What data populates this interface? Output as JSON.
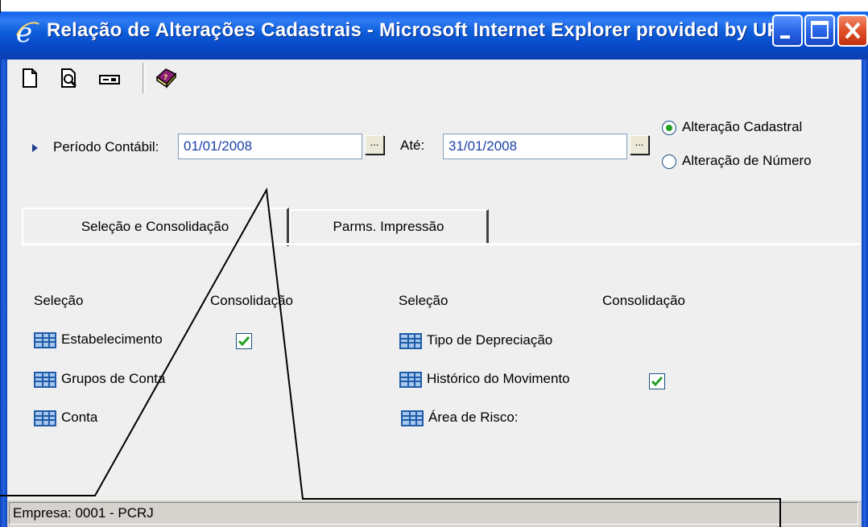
{
  "window": {
    "title": "Relação de Alterações Cadastrais - Microsoft Internet Explorer provided by UF…",
    "controls": [
      "minimize",
      "maximize",
      "close"
    ]
  },
  "toolbar": {
    "icons": [
      "new-document-icon",
      "print-preview-icon",
      "printer-setup-icon",
      "help-book-icon"
    ]
  },
  "filters": {
    "period_label": "Período Contábil:",
    "period_from": "01/01/2008",
    "until_label": "Até:",
    "period_to": "31/01/2008",
    "lookup_button": "...",
    "report_type": {
      "options": [
        "Alteração Cadastral",
        "Alteração de Número"
      ],
      "selected": "Alteração Cadastral"
    }
  },
  "tabs": [
    {
      "label": "Seleção e Consolidação",
      "active": true
    },
    {
      "label": "Parms. Impressão",
      "active": false
    }
  ],
  "left_panel": {
    "header_selection": "Seleção",
    "header_consolidation": "Consolidação",
    "items": [
      {
        "label": "Estabelecimento",
        "consolidation_checked": true
      },
      {
        "label": "Grupos de Conta",
        "consolidation_checked": false
      },
      {
        "label": "Conta",
        "consolidation_checked": false
      }
    ]
  },
  "right_panel": {
    "header_selection": "Seleção",
    "header_consolidation": "Consolidação",
    "items": [
      {
        "label": "Tipo de Depreciação",
        "consolidation_checked": false
      },
      {
        "label": "Histórico do Movimento",
        "consolidation_checked": true
      },
      {
        "label": "Área de Risco:",
        "consolidation_checked": false
      }
    ]
  },
  "status": {
    "company": "Empresa: 0001 - PCRJ"
  },
  "colors": {
    "title_bar": "#0c5cd9",
    "client_background": "#efefef",
    "input_text": "#1c3fa8",
    "check_green": "#21a121",
    "grid_icon_blue": "#1f5ba8"
  }
}
